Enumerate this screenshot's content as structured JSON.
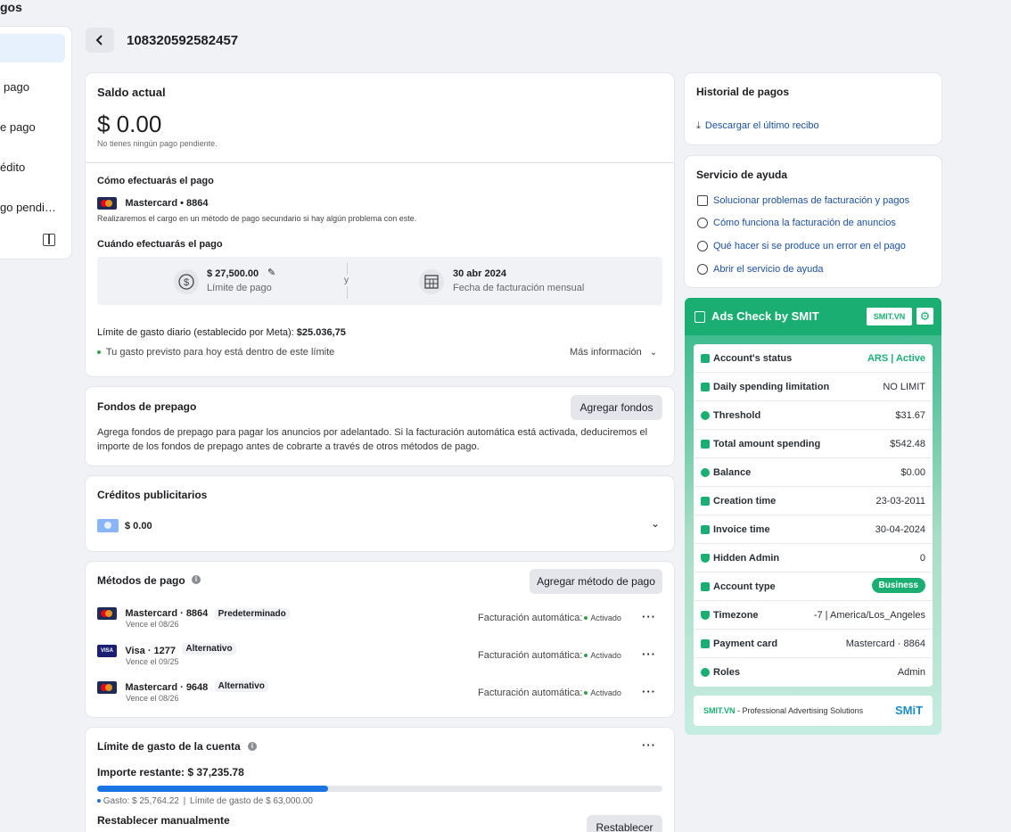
{
  "sidebar": {
    "title": "gos",
    "items": [
      {
        "label": "pago"
      },
      {
        "label": "e pago"
      },
      {
        "label": "édito"
      },
      {
        "label": "go pendi…"
      }
    ]
  },
  "header": {
    "account_id": "108320592582457"
  },
  "balance": {
    "title": "Saldo actual",
    "amount": "$ 0.00",
    "note": "No tienes ningún pago pendiente.",
    "how_title": "Cómo efectuarás el pago",
    "card_label": "Mastercard • 8864",
    "card_note": "Realizaremos el cargo en un método de pago secundario si hay algún problema con este.",
    "when_title": "Cuándo efectuarás el pago",
    "limit_amount": "$ 27,500.00",
    "limit_label": "Límite de pago",
    "and": "y",
    "date": "30 abr 2024",
    "date_label": "Fecha de facturación mensual",
    "daily_label": "Límite de gasto diario (establecido por Meta):",
    "daily_value": "$25.036,75",
    "forecast": "Tu gasto previsto para hoy está dentro de este límite",
    "more": "Más información"
  },
  "prepaid": {
    "title": "Fondos de prepago",
    "button": "Agregar fondos",
    "text1": "Agrega fondos de prepago para pagar los anuncios por adelantado. Si la facturación automática está activada, deduciremos el",
    "text2": "importe de los fondos de prepago antes de cobrarte a través de otros métodos de pago."
  },
  "credits": {
    "title": "Créditos publicitarios",
    "amount": "$ 0.00"
  },
  "methods": {
    "title": "Métodos de pago",
    "button": "Agregar método de pago",
    "items": [
      {
        "name": "Mastercard · 8864",
        "badge": "Predeterminado",
        "expiry": "Vence el 08/26",
        "auto": "Facturación automática:",
        "status": "Activado"
      },
      {
        "name": "Visa · 1277",
        "badge": "Alternativo",
        "expiry": "Vence el 09/25",
        "auto": "Facturación automática:",
        "status": "Activado"
      },
      {
        "name": "Mastercard · 9648",
        "badge": "Alternativo",
        "expiry": "Vence el 08/26",
        "auto": "Facturación automática:",
        "status": "Activado"
      }
    ]
  },
  "spend_limit": {
    "title": "Límite de gasto de la cuenta",
    "remaining": "Importe restante: $ 37,235.78",
    "spent": "Gasto: $ 25,764.22",
    "limit": "Límite de gasto de $ 63,000.00",
    "progress_fraction": 0.409,
    "reset_title": "Restablecer manualmente",
    "reset_button": "Restablecer"
  },
  "history": {
    "title": "Historial de pagos",
    "download": "Descargar el último recibo"
  },
  "help": {
    "title": "Servicio de ayuda",
    "items": [
      {
        "label": "Solucionar problemas de facturación y pagos"
      },
      {
        "label": "Cómo funciona la facturación de anuncios"
      },
      {
        "label": "Qué hacer si se produce un error en el pago"
      },
      {
        "label": "Abrir el servicio de ayuda"
      }
    ]
  },
  "smit": {
    "title": "Ads Check by SMIT",
    "badge": "SMIT.VN",
    "rows": [
      {
        "label": "Account's status",
        "value": "ARS | Active"
      },
      {
        "label": "Daily spending limitation",
        "value": "NO LIMIT"
      },
      {
        "label": "Threshold",
        "value": "$31.67"
      },
      {
        "label": "Total amount spending",
        "value": "$542.48"
      },
      {
        "label": "Balance",
        "value": "$0.00"
      },
      {
        "label": "Creation time",
        "value": "23-03-2011"
      },
      {
        "label": "Invoice time",
        "value": "30-04-2024"
      },
      {
        "label": "Hidden Admin",
        "value": "0"
      },
      {
        "label": "Account type",
        "value": "Business"
      },
      {
        "label": "Timezone",
        "value": "-7 | America/Los_Angeles"
      },
      {
        "label": "Payment card",
        "value": "Mastercard · 8864"
      },
      {
        "label": "Roles",
        "value": "Admin"
      }
    ],
    "footer_brand": "SMIT.VN",
    "footer_text": " - Professional Advertising Solutions",
    "footer_logo": "SMiT"
  }
}
